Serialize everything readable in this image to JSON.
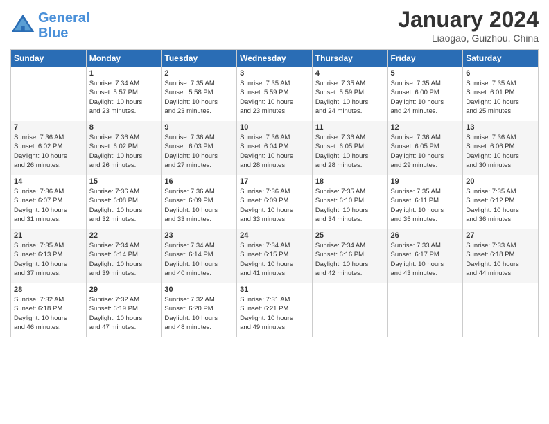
{
  "header": {
    "logo_line1": "General",
    "logo_line2": "Blue",
    "month": "January 2024",
    "location": "Liaogao, Guizhou, China"
  },
  "days_of_week": [
    "Sunday",
    "Monday",
    "Tuesday",
    "Wednesday",
    "Thursday",
    "Friday",
    "Saturday"
  ],
  "weeks": [
    [
      {
        "day": "",
        "info": ""
      },
      {
        "day": "1",
        "info": "Sunrise: 7:34 AM\nSunset: 5:57 PM\nDaylight: 10 hours\nand 23 minutes."
      },
      {
        "day": "2",
        "info": "Sunrise: 7:35 AM\nSunset: 5:58 PM\nDaylight: 10 hours\nand 23 minutes."
      },
      {
        "day": "3",
        "info": "Sunrise: 7:35 AM\nSunset: 5:59 PM\nDaylight: 10 hours\nand 23 minutes."
      },
      {
        "day": "4",
        "info": "Sunrise: 7:35 AM\nSunset: 5:59 PM\nDaylight: 10 hours\nand 24 minutes."
      },
      {
        "day": "5",
        "info": "Sunrise: 7:35 AM\nSunset: 6:00 PM\nDaylight: 10 hours\nand 24 minutes."
      },
      {
        "day": "6",
        "info": "Sunrise: 7:35 AM\nSunset: 6:01 PM\nDaylight: 10 hours\nand 25 minutes."
      }
    ],
    [
      {
        "day": "7",
        "info": "Sunrise: 7:36 AM\nSunset: 6:02 PM\nDaylight: 10 hours\nand 26 minutes."
      },
      {
        "day": "8",
        "info": "Sunrise: 7:36 AM\nSunset: 6:02 PM\nDaylight: 10 hours\nand 26 minutes."
      },
      {
        "day": "9",
        "info": "Sunrise: 7:36 AM\nSunset: 6:03 PM\nDaylight: 10 hours\nand 27 minutes."
      },
      {
        "day": "10",
        "info": "Sunrise: 7:36 AM\nSunset: 6:04 PM\nDaylight: 10 hours\nand 28 minutes."
      },
      {
        "day": "11",
        "info": "Sunrise: 7:36 AM\nSunset: 6:05 PM\nDaylight: 10 hours\nand 28 minutes."
      },
      {
        "day": "12",
        "info": "Sunrise: 7:36 AM\nSunset: 6:05 PM\nDaylight: 10 hours\nand 29 minutes."
      },
      {
        "day": "13",
        "info": "Sunrise: 7:36 AM\nSunset: 6:06 PM\nDaylight: 10 hours\nand 30 minutes."
      }
    ],
    [
      {
        "day": "14",
        "info": "Sunrise: 7:36 AM\nSunset: 6:07 PM\nDaylight: 10 hours\nand 31 minutes."
      },
      {
        "day": "15",
        "info": "Sunrise: 7:36 AM\nSunset: 6:08 PM\nDaylight: 10 hours\nand 32 minutes."
      },
      {
        "day": "16",
        "info": "Sunrise: 7:36 AM\nSunset: 6:09 PM\nDaylight: 10 hours\nand 33 minutes."
      },
      {
        "day": "17",
        "info": "Sunrise: 7:36 AM\nSunset: 6:09 PM\nDaylight: 10 hours\nand 33 minutes."
      },
      {
        "day": "18",
        "info": "Sunrise: 7:35 AM\nSunset: 6:10 PM\nDaylight: 10 hours\nand 34 minutes."
      },
      {
        "day": "19",
        "info": "Sunrise: 7:35 AM\nSunset: 6:11 PM\nDaylight: 10 hours\nand 35 minutes."
      },
      {
        "day": "20",
        "info": "Sunrise: 7:35 AM\nSunset: 6:12 PM\nDaylight: 10 hours\nand 36 minutes."
      }
    ],
    [
      {
        "day": "21",
        "info": "Sunrise: 7:35 AM\nSunset: 6:13 PM\nDaylight: 10 hours\nand 37 minutes."
      },
      {
        "day": "22",
        "info": "Sunrise: 7:34 AM\nSunset: 6:14 PM\nDaylight: 10 hours\nand 39 minutes."
      },
      {
        "day": "23",
        "info": "Sunrise: 7:34 AM\nSunset: 6:14 PM\nDaylight: 10 hours\nand 40 minutes."
      },
      {
        "day": "24",
        "info": "Sunrise: 7:34 AM\nSunset: 6:15 PM\nDaylight: 10 hours\nand 41 minutes."
      },
      {
        "day": "25",
        "info": "Sunrise: 7:34 AM\nSunset: 6:16 PM\nDaylight: 10 hours\nand 42 minutes."
      },
      {
        "day": "26",
        "info": "Sunrise: 7:33 AM\nSunset: 6:17 PM\nDaylight: 10 hours\nand 43 minutes."
      },
      {
        "day": "27",
        "info": "Sunrise: 7:33 AM\nSunset: 6:18 PM\nDaylight: 10 hours\nand 44 minutes."
      }
    ],
    [
      {
        "day": "28",
        "info": "Sunrise: 7:32 AM\nSunset: 6:18 PM\nDaylight: 10 hours\nand 46 minutes."
      },
      {
        "day": "29",
        "info": "Sunrise: 7:32 AM\nSunset: 6:19 PM\nDaylight: 10 hours\nand 47 minutes."
      },
      {
        "day": "30",
        "info": "Sunrise: 7:32 AM\nSunset: 6:20 PM\nDaylight: 10 hours\nand 48 minutes."
      },
      {
        "day": "31",
        "info": "Sunrise: 7:31 AM\nSunset: 6:21 PM\nDaylight: 10 hours\nand 49 minutes."
      },
      {
        "day": "",
        "info": ""
      },
      {
        "day": "",
        "info": ""
      },
      {
        "day": "",
        "info": ""
      }
    ]
  ]
}
